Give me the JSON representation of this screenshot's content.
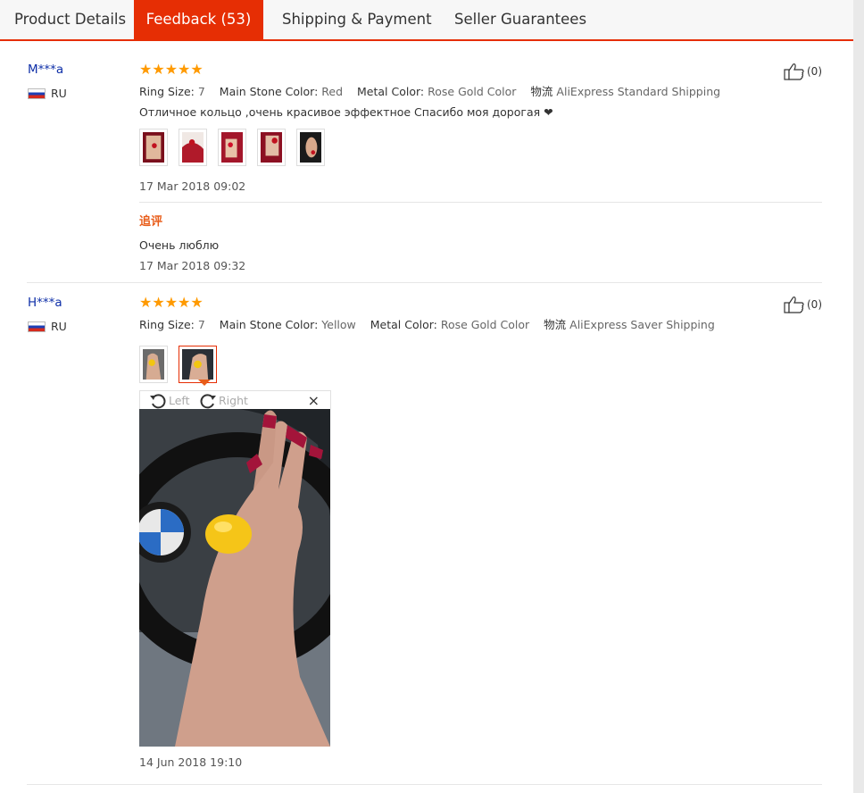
{
  "tabs": [
    {
      "label": "Product Details"
    },
    {
      "label": "Feedback (53)"
    },
    {
      "label": "Shipping & Payment"
    },
    {
      "label": "Seller Guarantees"
    }
  ],
  "reviews": [
    {
      "user": "M***a",
      "country": "RU",
      "rating": 5,
      "stars": "★★★★★",
      "likes": "(0)",
      "attributes": [
        {
          "key": "Ring Size:",
          "value": "7"
        },
        {
          "key": "Main Stone Color:",
          "value": "Red"
        },
        {
          "key": "Metal Color:",
          "value": "Rose Gold Color"
        },
        {
          "key": "物流",
          "value": "AliExpress Standard Shipping"
        }
      ],
      "comment": "Отличное кольцо ,очень красивое эффектное Спасибо моя дорогая ❤",
      "date": "17 Mar 2018 09:02",
      "additional": {
        "title": "追评",
        "comment": "Очень люблю",
        "date": "17 Mar 2018 09:32"
      }
    },
    {
      "user": "H***a",
      "country": "RU",
      "rating": 5,
      "stars": "★★★★★",
      "likes": "(0)",
      "attributes": [
        {
          "key": "Ring Size:",
          "value": "7"
        },
        {
          "key": "Main Stone Color:",
          "value": "Yellow"
        },
        {
          "key": "Metal Color:",
          "value": "Rose Gold Color"
        },
        {
          "key": "物流",
          "value": "AliExpress Saver Shipping"
        }
      ],
      "viewer": {
        "rotate_left": "Left",
        "rotate_right": "Right",
        "close": "×"
      },
      "date": "14 Jun 2018 19:10"
    }
  ],
  "colors": {
    "accent": "#e62e04",
    "star": "#ff9a00",
    "user_link": "#0e2fa8",
    "followup": "#e85d1a"
  }
}
